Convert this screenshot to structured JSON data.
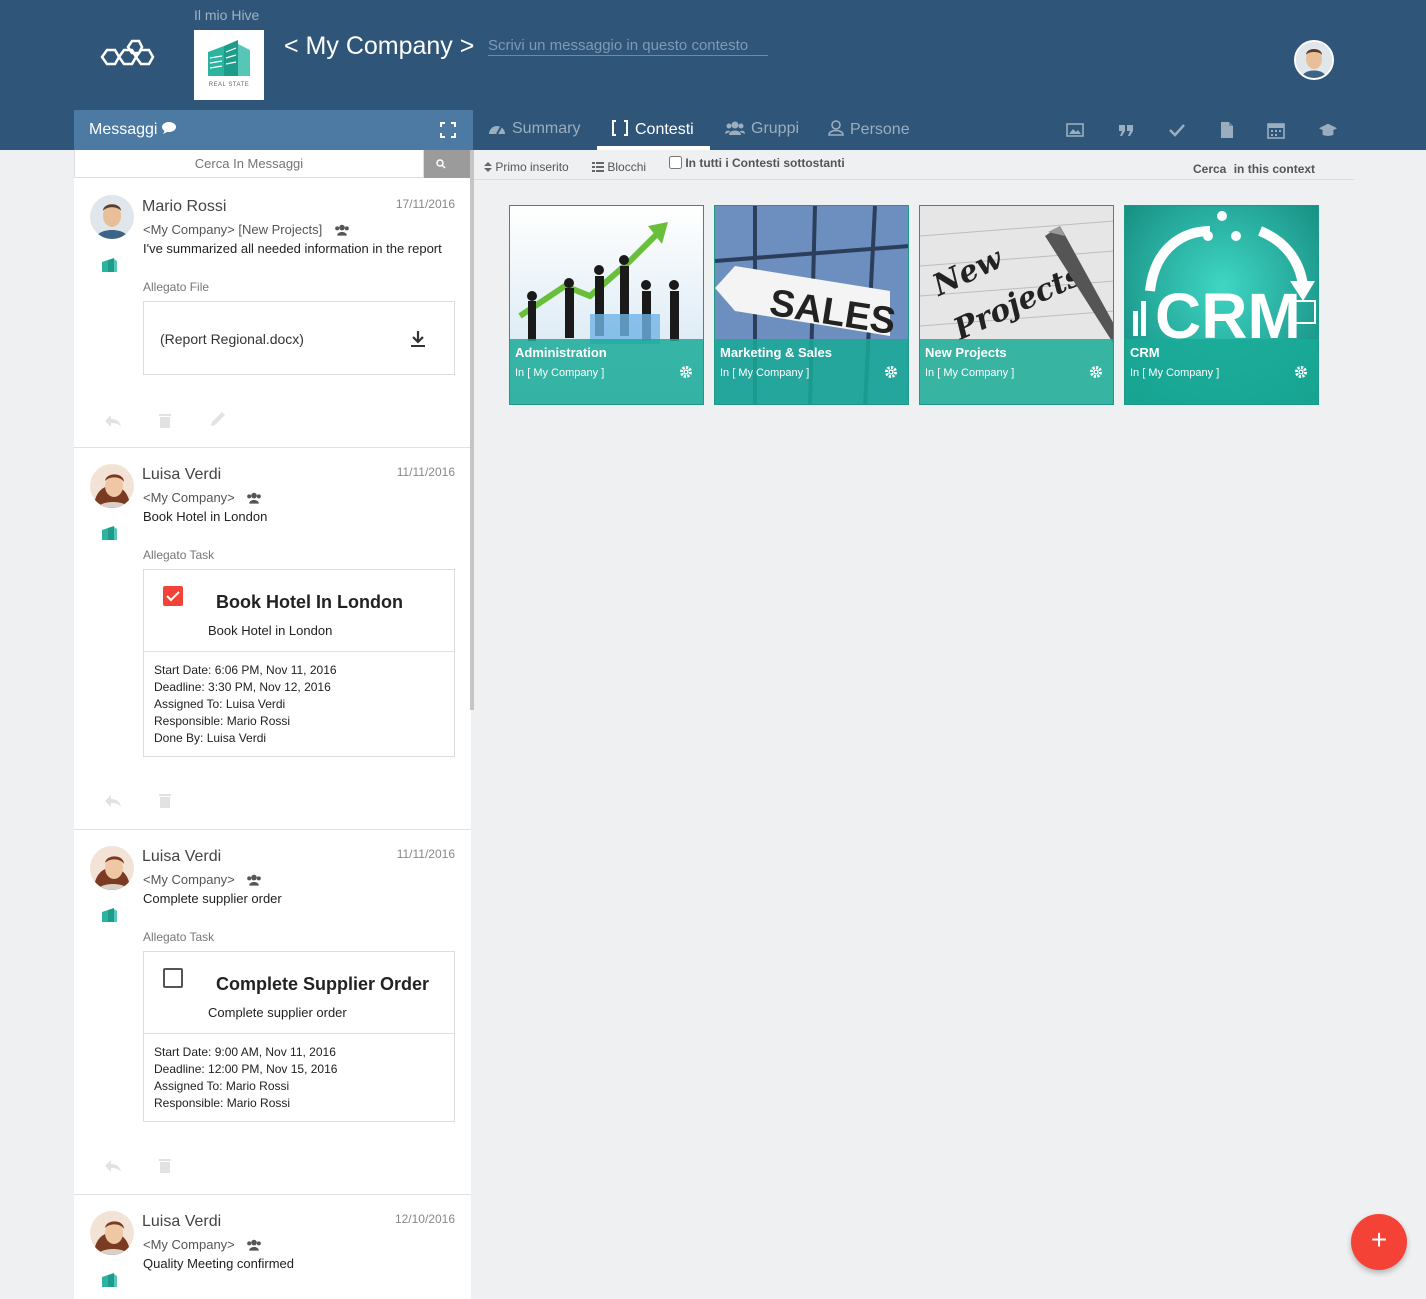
{
  "header": {
    "hive_label": "Il mio Hive",
    "company_logo_text": "REAL STATE",
    "context_title": "< My Company >",
    "message_placeholder": "Scrivi un messaggio in questo contesto"
  },
  "messages_panel": {
    "title": "Messaggi",
    "search_placeholder": "Cerca In Messaggi"
  },
  "tabs": [
    {
      "label": "Summary",
      "icon": "dashboard-icon",
      "active": false
    },
    {
      "label": "Contesti",
      "icon": "brackets-icon",
      "active": true
    },
    {
      "label": "Gruppi",
      "icon": "users-icon",
      "active": false
    },
    {
      "label": "Persone",
      "icon": "user-icon",
      "active": false
    }
  ],
  "toolbar_icons": [
    "image-icon",
    "quote-icon",
    "check-icon",
    "document-icon",
    "calendar-icon",
    "graduation-cap-icon"
  ],
  "sortbar": {
    "sort_label": "Primo inserito",
    "view_label": "Blocchi",
    "checkbox_label": "In tutti i Contesti sottostanti",
    "search_label": "Cerca",
    "search_scope": "in this context"
  },
  "messages": [
    {
      "author": "Mario Rossi",
      "date": "17/11/2016",
      "context": "<My Company>  [New Projects]",
      "text": "I've summarized all needed information in the report",
      "attachment_label": "Allegato File",
      "file_name": "(Report Regional.docx)"
    },
    {
      "author": "Luisa Verdi",
      "date": "11/11/2016",
      "context": "<My Company>",
      "text": "Book Hotel in London",
      "attachment_label": "Allegato Task",
      "task_title": "Book Hotel In London",
      "task_sub": "Book Hotel in London",
      "task_done": true,
      "details": [
        "Start Date: 6:06 PM, Nov 11, 2016",
        "Deadline: 3:30 PM, Nov 12, 2016",
        "Assigned To: Luisa Verdi",
        "Responsible: Mario Rossi",
        "Done By: Luisa Verdi"
      ]
    },
    {
      "author": "Luisa Verdi",
      "date": "11/11/2016",
      "context": "<My Company>",
      "text": "Complete supplier order",
      "attachment_label": "Allegato Task",
      "task_title": "Complete Supplier Order",
      "task_sub": "Complete supplier order",
      "task_done": false,
      "details": [
        "Start Date: 9:00 AM, Nov 11, 2016",
        "Deadline: 12:00 PM, Nov 15, 2016",
        "Assigned To: Mario Rossi",
        "Responsible: Mario Rossi"
      ]
    },
    {
      "author": "Luisa Verdi",
      "date": "12/10/2016",
      "context": "<My Company>",
      "text": "Quality Meeting confirmed"
    }
  ],
  "contexts": [
    {
      "name": "Administration",
      "parent": "In [ My Company ]"
    },
    {
      "name": "Marketing & Sales",
      "parent": "In [ My Company ]"
    },
    {
      "name": "New Projects",
      "parent": "In [ My Company ]"
    },
    {
      "name": "CRM",
      "parent": "In [ My Company ]"
    }
  ],
  "card_images": {
    "sales": "SALES",
    "new_projects": [
      "New",
      "Projects"
    ],
    "crm": "CRM"
  },
  "fab_label": "+",
  "colors": {
    "header": "#2f5578",
    "messages_bar": "#4d7aa3",
    "card_overlay": "#19aa96",
    "fab": "#f44336",
    "task_done": "#f44336"
  }
}
